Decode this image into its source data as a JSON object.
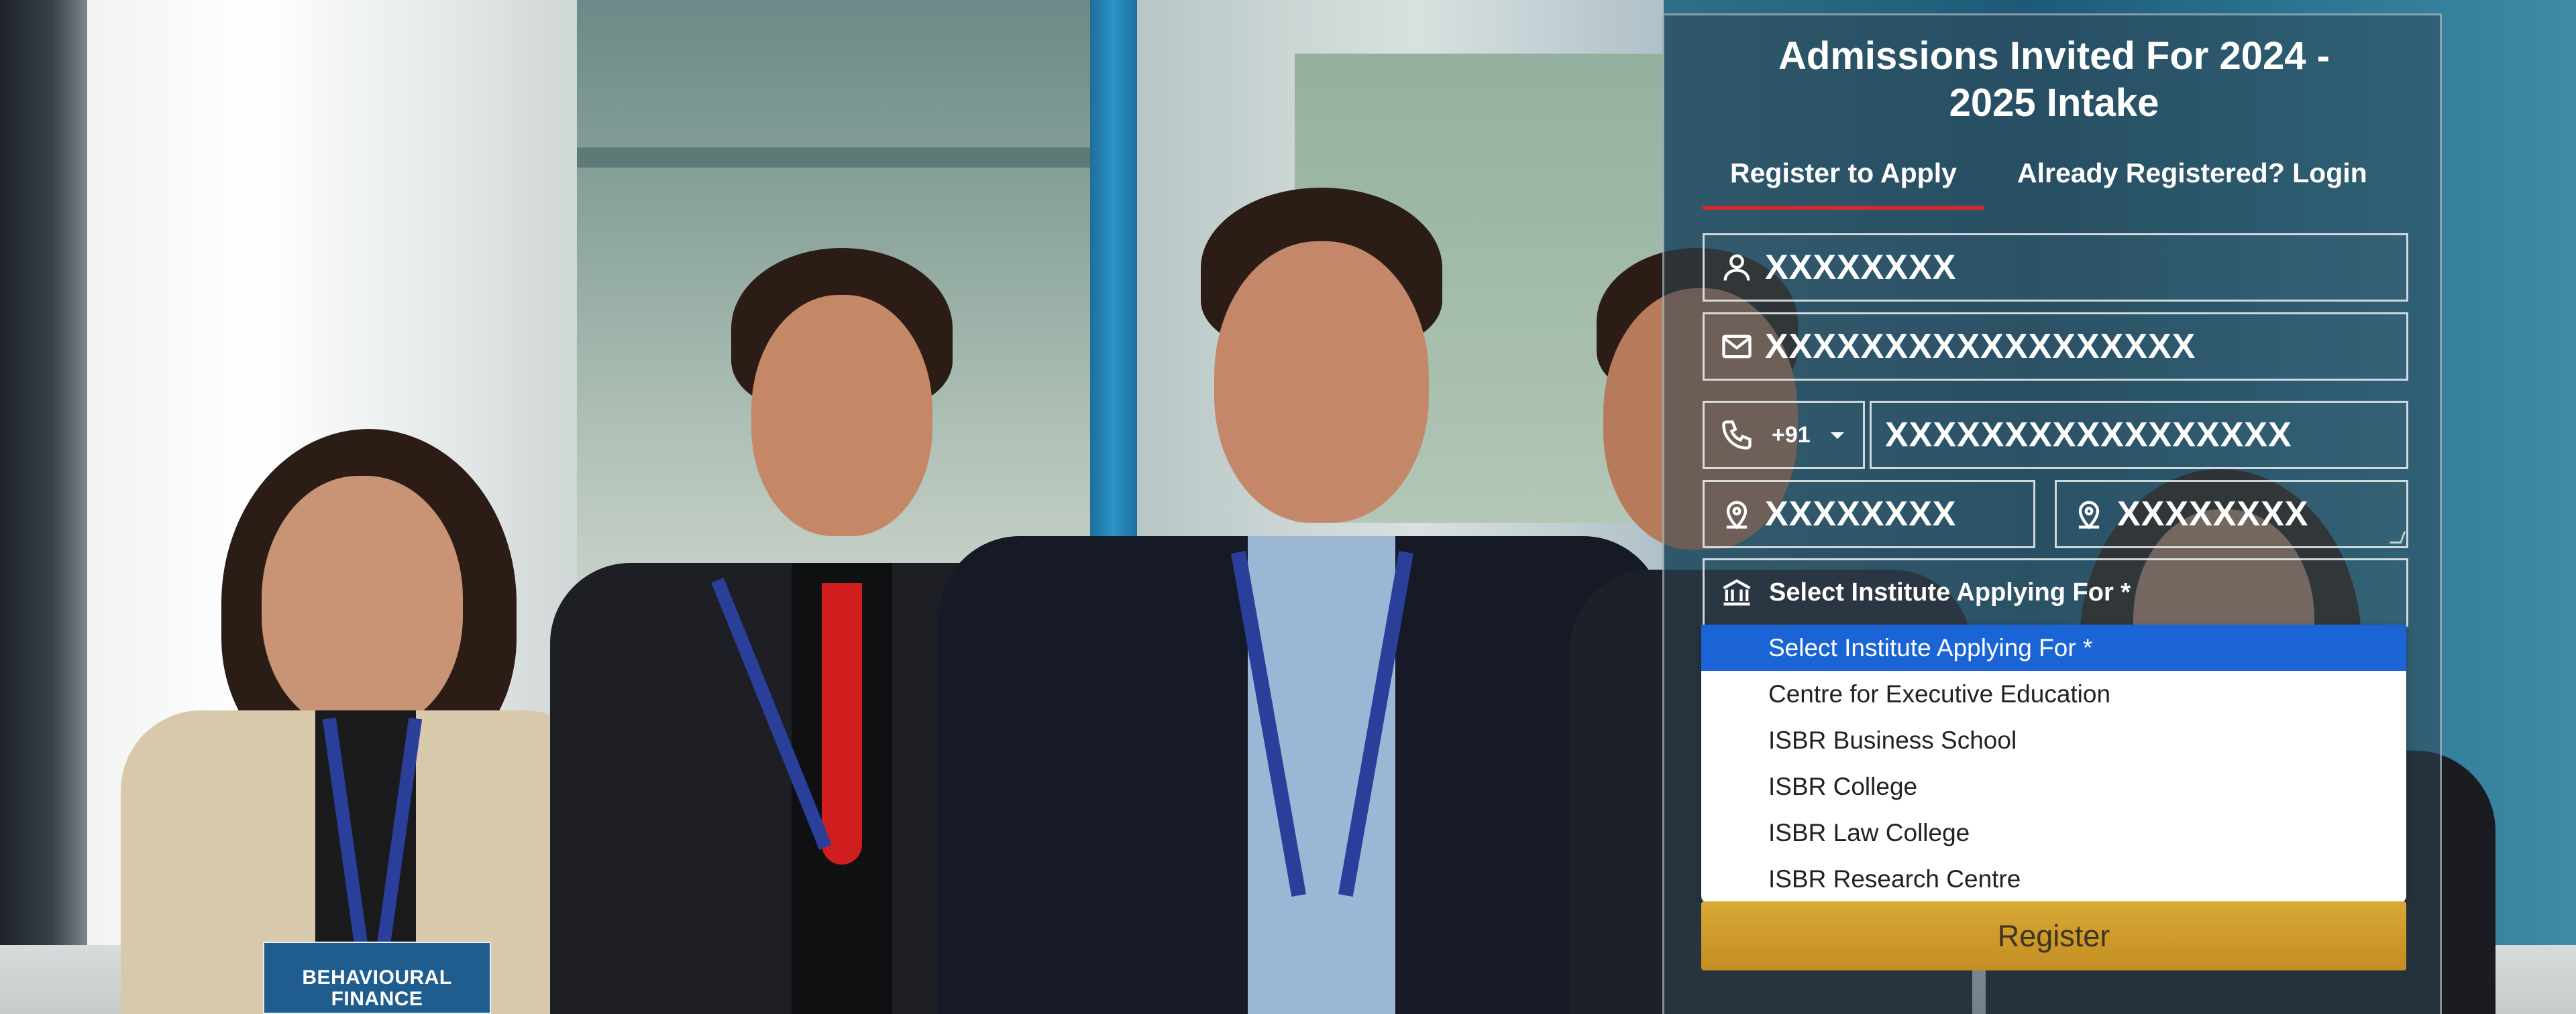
{
  "form": {
    "title_line1": "Admissions Invited For 2024 -",
    "title_line2": "2025 Intake",
    "tabs": {
      "register": "Register to Apply",
      "login": "Already Registered? Login"
    },
    "fields": {
      "name": {
        "value": "XXXXXXXX",
        "icon": "user-icon"
      },
      "email": {
        "value": "XXXXXXXXXXXXXXXXXX",
        "icon": "envelope-icon"
      },
      "country_code": {
        "value": "+91",
        "icon": "phone-icon"
      },
      "phone": {
        "value": "XXXXXXXXXXXXXXXXX"
      },
      "state": {
        "value": "XXXXXXXX",
        "icon": "location-pin-icon"
      },
      "city": {
        "value": "XXXXXXXX",
        "icon": "location-pin-icon"
      },
      "institute": {
        "value": "Select Institute Applying For *",
        "icon": "building-icon"
      }
    },
    "institute_options": [
      "Select Institute Applying For *",
      "Centre for Executive Education",
      "ISBR Business School",
      "ISBR College",
      "ISBR Law College",
      "ISBR Research Centre"
    ],
    "selected_option_index": 0,
    "register_label": "Register"
  },
  "background": {
    "book_text_line1": "BEHAVIOURAL",
    "book_text_line2": "FINANCE"
  },
  "colors": {
    "accent_red": "#d4282a",
    "selected_option_bg": "#1a64d6",
    "register_button": "#c9962a"
  }
}
